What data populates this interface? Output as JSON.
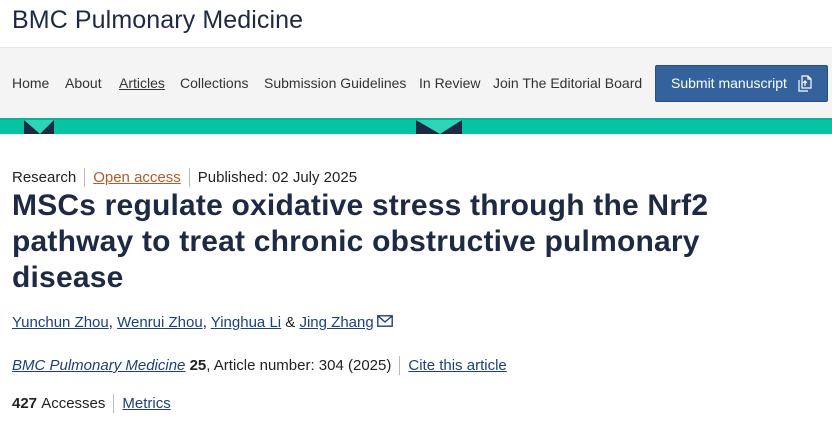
{
  "journal": {
    "title": "BMC Pulmonary Medicine"
  },
  "nav": {
    "items": [
      {
        "label": "Home"
      },
      {
        "label": "About"
      },
      {
        "label": "Articles"
      },
      {
        "label": "Collections"
      },
      {
        "label": "Submission Guidelines"
      },
      {
        "label": "In Review"
      },
      {
        "label": "Join The Editorial Board"
      }
    ],
    "active_item": "Articles",
    "submit_label": "Submit manuscript"
  },
  "colors": {
    "brand_navy": "#1e2a43",
    "nav_background": "#f4f4f4",
    "submit_button": "#33629d",
    "banner_teal": "#05c3a3",
    "open_access": "#b35a2a",
    "link": "#1e3f7a"
  },
  "article": {
    "type": "Research",
    "access": "Open access",
    "published": "Published: 02 July 2025",
    "title": "MSCs regulate oxidative stress through the Nrf2 pathway to treat chronic obstructive pulmonary disease",
    "authors": [
      {
        "name": "Yunchun Zhou",
        "after": ", "
      },
      {
        "name": "Wenrui Zhou",
        "after": ", "
      },
      {
        "name": "Yinghua Li",
        "after": " & "
      },
      {
        "name": "Jing Zhang",
        "after": ""
      }
    ],
    "citation": {
      "journal": "BMC Pulmonary Medicine",
      "volume": "25",
      "article_number": ", Article number: 304 (2025)",
      "cite_label": "Cite this article"
    },
    "metrics": {
      "accesses_count": "427",
      "accesses_label": "Accesses",
      "metrics_label": "Metrics"
    }
  },
  "icons": {
    "submit": "external-document-icon",
    "corresponding_author": "envelope-icon"
  }
}
